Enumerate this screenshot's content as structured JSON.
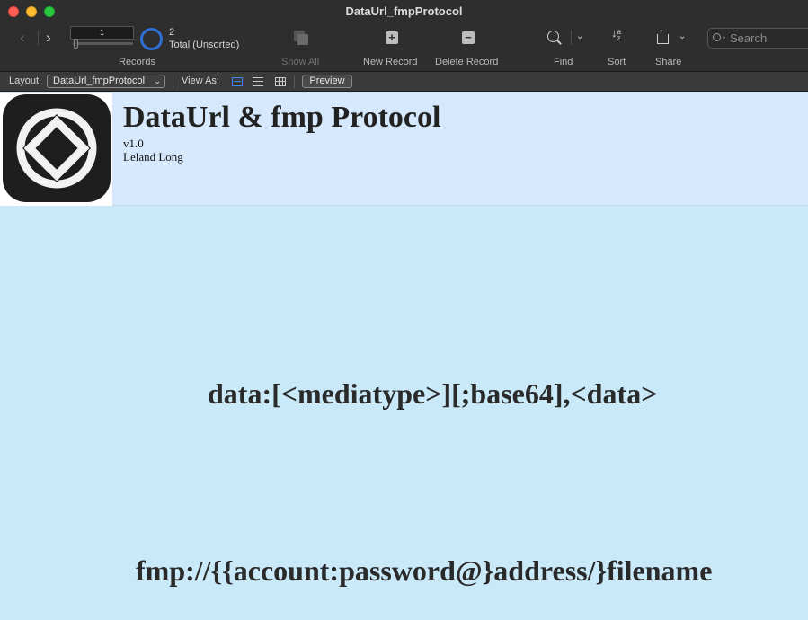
{
  "window": {
    "title": "DataUrl_fmpProtocol"
  },
  "toolbar": {
    "record_number": "1",
    "found_count": "2",
    "total_label": "Total (Unsorted)",
    "records_label": "Records",
    "show_all_label": "Show All",
    "new_record_label": "New Record",
    "delete_record_label": "Delete Record",
    "find_label": "Find",
    "sort_label": "Sort",
    "share_label": "Share",
    "search_placeholder": "Search",
    "new_record_glyph": "+",
    "delete_record_glyph": "−",
    "sort_glyph_top": "a",
    "sort_glyph_bottom": "z"
  },
  "layout_bar": {
    "layout_label": "Layout:",
    "layout_value": "DataUrl_fmpProtocol",
    "view_as_label": "View As:",
    "preview_label": "Preview"
  },
  "header": {
    "title": "DataUrl & fmp Protocol",
    "version": "v1.0",
    "author": "Leland Long"
  },
  "content": {
    "data_url_syntax": "data:[<mediatype>][;base64],<data>",
    "fmp_syntax": "fmp://{{account:password@}address/}filename"
  },
  "colors": {
    "header_band": "#d6e9fc",
    "body_background": "#c9e9f8",
    "toolbar": "#2e2e2e",
    "accent": "#3f86f7"
  }
}
